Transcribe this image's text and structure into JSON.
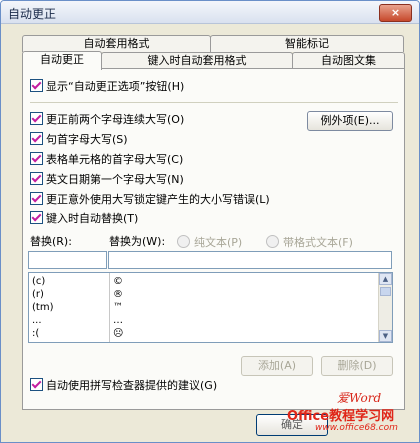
{
  "window": {
    "title": "自动更正",
    "close_glyph": "×"
  },
  "tabs": {
    "back": [
      {
        "label": "自动套用格式"
      },
      {
        "label": "智能标记"
      }
    ],
    "front": [
      {
        "label": "自动更正"
      },
      {
        "label": "键入时自动套用格式"
      },
      {
        "label": "自动图文集"
      }
    ]
  },
  "options": {
    "show_buttons": "显示“自动更正选项”按钮(H)",
    "items": [
      "更正前两个字母连续大写(O)",
      "句首字母大写(S)",
      "表格单元格的首字母大写(C)",
      "英文日期第一个字母大写(N)",
      "更正意外使用大写锁定键产生的大小写错误(L)"
    ],
    "exceptions_button": "例外项(E)...",
    "replace_while_typing": "键入时自动替换(T)"
  },
  "replace": {
    "replace_label": "替换(R):",
    "with_label": "替换为(W):",
    "plain_text": "纯文本(P)",
    "formatted_text": "带格式文本(F)",
    "replace_value": "",
    "with_value": "",
    "list": [
      {
        "from": "(c)",
        "to": "©"
      },
      {
        "from": "(r)",
        "to": "®"
      },
      {
        "from": "(tm)",
        "to": "™"
      },
      {
        "from": "...",
        "to": "…"
      },
      {
        "from": ":(",
        "to": "☹"
      }
    ],
    "add_button": "添加(A)",
    "delete_button": "删除(D)"
  },
  "spell_checker": "自动使用拼写检查器提供的建议(G)",
  "footer": {
    "ok_label": "确定"
  },
  "watermark": {
    "line1": "爱Word",
    "line2": "Office教程学习网",
    "line3": "www.office68.com"
  },
  "colors": {
    "check_mark": "#c41ea0",
    "watermark": "#e02618",
    "title_bar": "#d9e1ef"
  }
}
